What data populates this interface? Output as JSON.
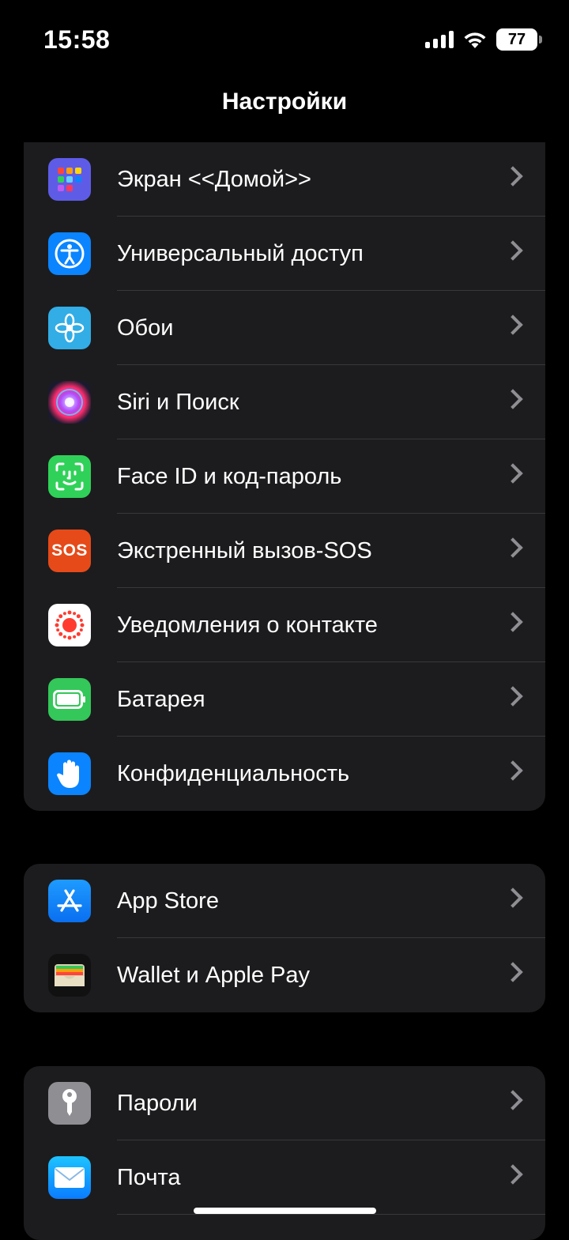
{
  "status_bar": {
    "time": "15:58",
    "battery": "77"
  },
  "nav": {
    "title": "Настройки"
  },
  "groups": [
    {
      "items": [
        {
          "label": "Экран <<Домой>>",
          "icon": "home-screen-icon",
          "color": "#5e5ce6"
        },
        {
          "label": "Универсальный доступ",
          "icon": "accessibility-icon",
          "color": "#0a84ff"
        },
        {
          "label": "Обои",
          "icon": "wallpaper-icon",
          "color": "#32ade6"
        },
        {
          "label": "Siri и Поиск",
          "icon": "siri-icon",
          "color": "#1c1c1e"
        },
        {
          "label": "Face ID и код-пароль",
          "icon": "face-id-icon",
          "color": "#30d158"
        },
        {
          "label": "Экстренный вызов-SOS",
          "icon": "sos-icon",
          "color": "#e64a19",
          "icon_text": "SOS"
        },
        {
          "label": "Уведомления о контакте",
          "icon": "exposure-notification-icon",
          "color": "#ffffff"
        },
        {
          "label": "Батарея",
          "icon": "battery-icon",
          "color": "#34c759"
        },
        {
          "label": "Конфиденциальность",
          "icon": "privacy-hand-icon",
          "color": "#0a84ff"
        }
      ]
    },
    {
      "items": [
        {
          "label": "App Store",
          "icon": "app-store-icon",
          "color": "#0a84ff"
        },
        {
          "label": "Wallet и Apple Pay",
          "icon": "wallet-icon",
          "color": "#1c1c1e"
        }
      ]
    },
    {
      "items": [
        {
          "label": "Пароли",
          "icon": "passwords-key-icon",
          "color": "#8e8e93"
        },
        {
          "label": "Почта",
          "icon": "mail-icon",
          "color": "#0a84ff"
        }
      ]
    }
  ]
}
